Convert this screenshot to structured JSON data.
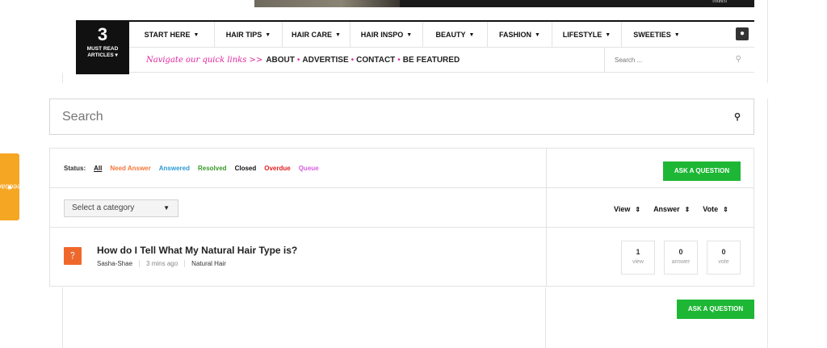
{
  "banner": {
    "caption": "council"
  },
  "must_read": {
    "count": "3",
    "label": "MUST READ ARTICLES ▾"
  },
  "menu": [
    {
      "label": "START HERE",
      "caret": "▼"
    },
    {
      "label": "HAIR TIPS",
      "caret": "▼"
    },
    {
      "label": "HAIR CARE",
      "caret": "▼"
    },
    {
      "label": "HAIR INSPO",
      "caret": "▼"
    },
    {
      "label": "BEAUTY",
      "caret": "▼"
    },
    {
      "label": "FASHION",
      "caret": "▼"
    },
    {
      "label": "LIFESTYLE",
      "caret": "▼"
    },
    {
      "label": "SWEETIES",
      "caret": "▼"
    }
  ],
  "quicklinks": {
    "intro": "Navigate our quick links >>",
    "links": [
      "ABOUT",
      "ADVERTISE",
      "CONTACT",
      "BE FEATURED"
    ],
    "separator": "•"
  },
  "nav_search": {
    "placeholder": "Search ..."
  },
  "main_search": {
    "placeholder": "Search"
  },
  "status_filter": {
    "label": "Status:",
    "items": [
      {
        "label": "All",
        "color": "#111111"
      },
      {
        "label": "Need Answer",
        "color": "#f5773a"
      },
      {
        "label": "Answered",
        "color": "#2d9ad6"
      },
      {
        "label": "Resolved",
        "color": "#3a9a28"
      },
      {
        "label": "Closed",
        "color": "#111111"
      },
      {
        "label": "Overdue",
        "color": "#e31e1e"
      },
      {
        "label": "Queue",
        "color": "#d65ee0"
      }
    ]
  },
  "ask_button": {
    "label": "ASK A QUESTION",
    "color": "#1db735"
  },
  "category_select": {
    "value": "Select a category"
  },
  "sort": [
    {
      "label": "View",
      "arrow": "⇕"
    },
    {
      "label": "Answer",
      "arrow": "⇕"
    },
    {
      "label": "Vote",
      "arrow": "⇕"
    }
  ],
  "question": {
    "title": "How do I Tell What My Natural Hair Type is?",
    "author": "Sasha-Shae",
    "time": "3 mins ago",
    "category": "Natural Hair",
    "icon": "question-icon",
    "stats": [
      {
        "value": "1",
        "label": "view"
      },
      {
        "value": "0",
        "label": "answer"
      },
      {
        "value": "0",
        "label": "vote"
      }
    ]
  },
  "feedback": {
    "label": "Feedback"
  }
}
